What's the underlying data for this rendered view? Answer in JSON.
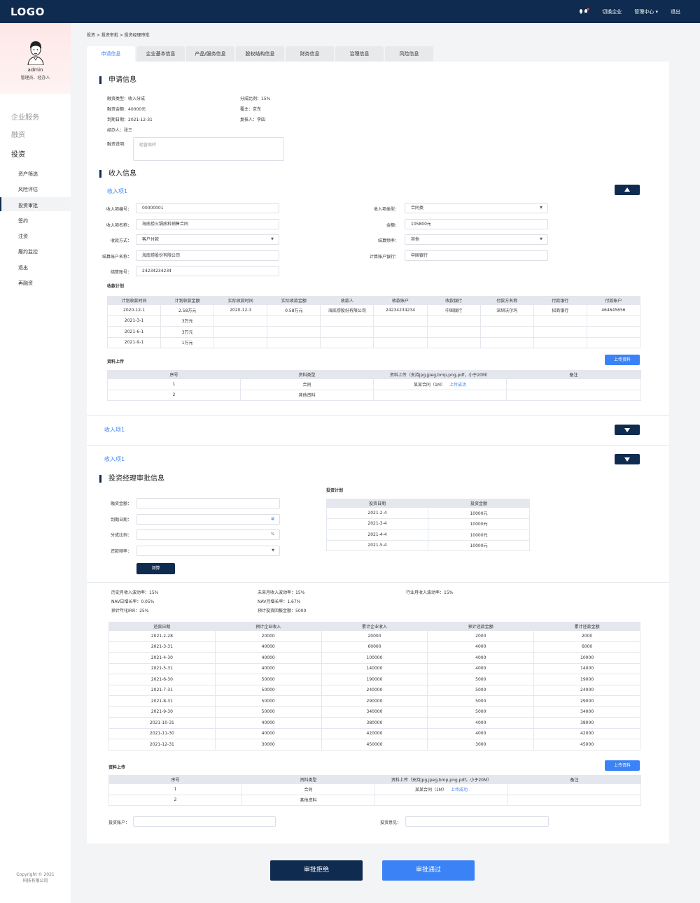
{
  "header": {
    "logo": "LOGO",
    "switch": "切换企业",
    "admin_center": "管理中心",
    "logout": "退出"
  },
  "sidebar": {
    "user_name": "admin",
    "user_role": "管理员、经办人",
    "groups": [
      "企业服务",
      "融资",
      "投资"
    ],
    "items": [
      "资产筛选",
      "风险评估",
      "投资审批",
      "签约",
      "注资",
      "履约监控",
      "退出",
      "再融资"
    ],
    "copyright": "Copyright © 2021",
    "company": "科技有限公司"
  },
  "breadcrumb": "投资 > 投资审批 > 投资经理审批",
  "tabs": [
    "申请信息",
    "企业基本信息",
    "产品/服务信息",
    "股权结构信息",
    "财务信息",
    "治理信息",
    "风险信息"
  ],
  "apply": {
    "title": "申请信息",
    "type": "融资类型：收入分成",
    "amount": "融资金额：40000元",
    "due": "到期日期：2021-12-31",
    "handler": "经办人：张三",
    "ratio": "分成比例：15%",
    "supervisor": "覆主：京东",
    "reviewer": "复核人：李四",
    "desc_label": "融资说明：",
    "desc_value": "经营周转"
  },
  "income": {
    "title": "收入信息",
    "item_title": "收入项1",
    "labels": {
      "no": "收入项编号：",
      "name": "收入项名称：",
      "pay_method": "收款方式：",
      "account_name": "结算账户名称：",
      "account_no": "结算账号：",
      "type": "收入项类型：",
      "amount": "金额：",
      "freq": "结算频率：",
      "bank": "计算账户银行："
    },
    "values": {
      "no": "00000001",
      "name": "海底捞火锅底料销售合同",
      "pay_method": "客户付款",
      "account_name": "海底捞股份有限公司",
      "account_no": "24234234234",
      "type": "合同类",
      "amount": "105800元",
      "freq": "其他",
      "bank": "中国银行"
    },
    "plan_title": "收款计划",
    "plan_headers": [
      "计划收款时间",
      "计划收款金额",
      "实际收款时间",
      "实际收款金额",
      "收款人",
      "收款账户",
      "收款银行",
      "付款方名称",
      "付款银行",
      "付款账户"
    ],
    "plan_rows": [
      [
        "2020-12-1",
        "2.58万元",
        "2020-12-3",
        "0.58万元",
        "海底捞股份有限公司",
        "24234234234",
        "中国银行",
        "深圳沃尔玛",
        "招商银行",
        "464645656"
      ],
      [
        "2021-3-1",
        "3万元",
        "",
        "",
        "",
        "",
        "",
        "",
        "",
        ""
      ],
      [
        "2021-6-1",
        "3万元",
        "",
        "",
        "",
        "",
        "",
        "",
        "",
        ""
      ],
      [
        "2021-9-1",
        "1万元",
        "",
        "",
        "",
        "",
        "",
        "",
        "",
        ""
      ]
    ],
    "upload_title": "资料上传",
    "upload_btn": "上传资料",
    "upload_headers": [
      "序号",
      "资料类型",
      "资料上传（支持jpg,jpeg,bmp,png,pdf，小于20M）",
      "备注"
    ],
    "upload_rows": [
      {
        "no": "1",
        "type": "合同",
        "file": "某某合同（1M）",
        "status": "上传成功",
        "note": ""
      },
      {
        "no": "2",
        "type": "其他资料",
        "file": "",
        "status": "",
        "note": ""
      }
    ],
    "collapsed_1": "收入项1",
    "collapsed_2": "收入项1"
  },
  "approval": {
    "title": "投资经理审批信息",
    "labels": {
      "amount": "融资金额：",
      "due": "到期日期：",
      "ratio": "分成比例：",
      "freq": "还款频率："
    },
    "ratio_unit": "%",
    "calc_btn": "测算",
    "plan_title": "投资计划",
    "plan_headers": [
      "投资日期",
      "投资金额"
    ],
    "plan_rows": [
      [
        "2021-2-4",
        "10000元"
      ],
      [
        "2021-3-4",
        "10000元"
      ],
      [
        "2021-4-4",
        "10000元"
      ],
      [
        "2021-5-4",
        "10000元"
      ]
    ],
    "metrics": [
      "历史月收入波动率：15%",
      "未来月收入波动率：15%",
      "行业月收入波动率：15%",
      "NAV日增长率：0.05%",
      "NAV月增长率：1.67%",
      "预计年化IRR：25%",
      "预计投资回报金额：5000"
    ],
    "repay_headers": [
      "还款日期",
      "预计企业收入",
      "累计企业收入",
      "预计还款金额",
      "累计还款金额"
    ],
    "repay_rows": [
      [
        "2021-2-28",
        "20000",
        "20000",
        "2000",
        "2000"
      ],
      [
        "2021-3-31",
        "40000",
        "60000",
        "4000",
        "6000"
      ],
      [
        "2021-4-30",
        "40000",
        "100000",
        "4000",
        "10000"
      ],
      [
        "2021-5-31",
        "40000",
        "140000",
        "4000",
        "14000"
      ],
      [
        "2021-6-30",
        "50000",
        "190000",
        "5000",
        "19000"
      ],
      [
        "2021-7-31",
        "50000",
        "240000",
        "5000",
        "24000"
      ],
      [
        "2021-8-31",
        "50000",
        "290000",
        "5000",
        "29000"
      ],
      [
        "2021-9-30",
        "50000",
        "340000",
        "5000",
        "34000"
      ],
      [
        "2021-10-31",
        "40000",
        "380000",
        "4000",
        "38000"
      ],
      [
        "2021-11-30",
        "40000",
        "420000",
        "4000",
        "42000"
      ],
      [
        "2021-12-31",
        "30000",
        "450000",
        "3000",
        "45000"
      ]
    ],
    "upload_title": "资料上传",
    "upload_btn": "上传资料",
    "upload_headers": [
      "序号",
      "资料类型",
      "资料上传（支持jpg,jpeg,bmp,png,pdf，小于20M）",
      "备注"
    ],
    "upload_rows": [
      {
        "no": "1",
        "type": "合同",
        "file": "某某合同（1M）",
        "status": "上传成功",
        "note": ""
      },
      {
        "no": "2",
        "type": "其他资料",
        "file": "",
        "status": "",
        "note": ""
      }
    ],
    "invest_account_label": "投资账户：",
    "invest_opinion_label": "投资意见："
  },
  "actions": {
    "reject": "审批拒绝",
    "approve": "审批通过"
  },
  "colors": {
    "navy": "#0f2b4f",
    "accent": "#3b82f6"
  }
}
